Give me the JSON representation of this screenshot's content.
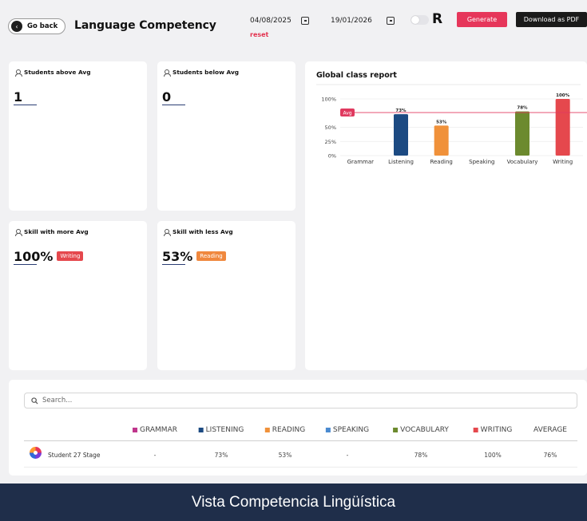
{
  "header": {
    "back_label": "Go back",
    "title": "Language Competency",
    "date_from": "04/08/2025",
    "date_to": "19/01/2026",
    "reset_label": "reset",
    "logo_text": "R",
    "generate_label": "Generate",
    "pdf_label": "Download as PDF"
  },
  "cards": {
    "above": {
      "label": "Students above Avg",
      "value": "1"
    },
    "below": {
      "label": "Students below Avg",
      "value": "0"
    },
    "more": {
      "label": "Skill with more Avg",
      "value": "100%",
      "badge": "Writing",
      "badge_color": "#e5484d"
    },
    "less": {
      "label": "Skill with less Avg",
      "value": "53%",
      "badge": "Reading",
      "badge_color": "#f0883e"
    }
  },
  "chart_data": {
    "type": "bar",
    "title": "Global class report",
    "categories": [
      "Grammar",
      "Listening",
      "Reading",
      "Speaking",
      "Vocabulary",
      "Writing"
    ],
    "values": [
      null,
      73,
      53,
      null,
      78,
      100
    ],
    "value_labels": [
      "",
      "73%",
      "53%",
      "",
      "78%",
      "100%"
    ],
    "colors": [
      "#c0368c",
      "#1c4a82",
      "#f0913a",
      "#4a8ad0",
      "#6c8a2e",
      "#e5484d"
    ],
    "yticks": [
      "0%",
      "25%",
      "50%",
      "100%"
    ],
    "ylim": [
      0,
      100
    ],
    "avg": {
      "label": "Avg",
      "value": 76,
      "color": "#e03a5f"
    }
  },
  "table": {
    "search_placeholder": "Search...",
    "columns": [
      {
        "label": "GRAMMAR",
        "color": "#c0368c"
      },
      {
        "label": "LISTENING",
        "color": "#1c4a82"
      },
      {
        "label": "READING",
        "color": "#f0913a"
      },
      {
        "label": "SPEAKING",
        "color": "#4a8ad0"
      },
      {
        "label": "VOCABULARY",
        "color": "#6c8a2e"
      },
      {
        "label": "WRITING",
        "color": "#e5484d"
      },
      {
        "label": "AVERAGE",
        "color": ""
      }
    ],
    "rows": [
      {
        "name": "Student 27 Stage",
        "values": [
          "-",
          "73%",
          "53%",
          "-",
          "78%",
          "100%",
          "76%"
        ]
      }
    ]
  },
  "footer": {
    "caption": "Vista Competencia Lingüística"
  }
}
